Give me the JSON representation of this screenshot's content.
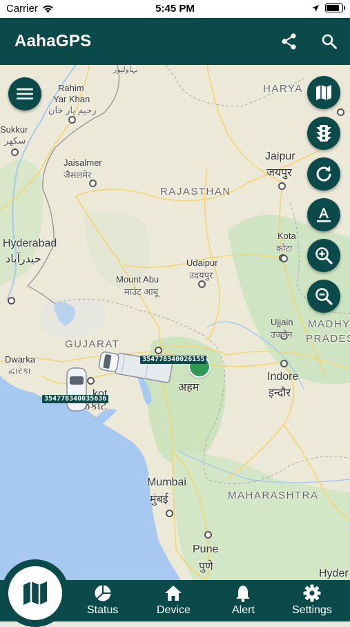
{
  "status_bar": {
    "carrier": "Carrier",
    "time": "5:45 PM",
    "battery_level": 0.9
  },
  "app_bar": {
    "title": "AahaGPS",
    "icons": [
      "share-icon",
      "search-icon"
    ]
  },
  "map": {
    "labels": {
      "bahawalpur": "بہاولپور",
      "rahim": "Rahim",
      "yar_khan": "Yar Khan",
      "rahim_ur": "رحیم یار خان",
      "sukkur": "Sukkur",
      "sukkur_ur": "سکھر",
      "haryana": "HARYA",
      "jaisalmer": "Jaisalmer",
      "jaisalmer_hi": "जैसलमेर",
      "jaipur": "Jaipur",
      "jaipur_hi": "जयपुर",
      "rajasthan": "RAJASTHAN",
      "hyderabad": "Hyderabad",
      "hyderabad_ur": "حیدرآباد",
      "kota": "Kota",
      "kota_hi": "कोटा",
      "udaipur": "Udaipur",
      "udaipur_hi": "उदयपुर",
      "mount_abu": "Mount Abu",
      "mount_abu_hi": "माउंट आबू",
      "ujjain": "Ujjain",
      "ujjain_hi": "उज्जैन",
      "madhya1": "MADHY",
      "madhya2": "PRADES",
      "gujarat": "GUJARAT",
      "dwarka": "Dwarka",
      "dwarka_gu": "દ્વારકા",
      "rajkot_part": "kot",
      "rajkot_gu": "રાજકોટ",
      "indore": "Indore",
      "indore_hi": "इन्दौर",
      "mumbai": "Mumbai",
      "mumbai_hi": "मुंबई",
      "maharashtra": "MAHARASHTRA",
      "pune": "Pune",
      "pune_hi": "पुणे",
      "hyder_right": "Hyder",
      "ahmedabad_part": "अहम"
    },
    "vehicles": [
      {
        "id": "354778340026155"
      },
      {
        "id": "354778340035636"
      }
    ],
    "controls": [
      "map-layer-icon",
      "traffic-icon",
      "refresh-icon",
      "label-icon",
      "zoom-in-icon",
      "zoom-out-icon"
    ]
  },
  "bottom_nav": {
    "items": [
      {
        "label": "Status",
        "icon": "pie-chart-icon"
      },
      {
        "label": "Device",
        "icon": "home-icon"
      },
      {
        "label": "Alert",
        "icon": "bell-icon"
      },
      {
        "label": "Settings",
        "icon": "gear-icon"
      }
    ]
  },
  "colors": {
    "primary": "#0b4a4b",
    "water": "#a7c8f0",
    "land": "#ece9d9",
    "green": "#c8e3bf"
  }
}
